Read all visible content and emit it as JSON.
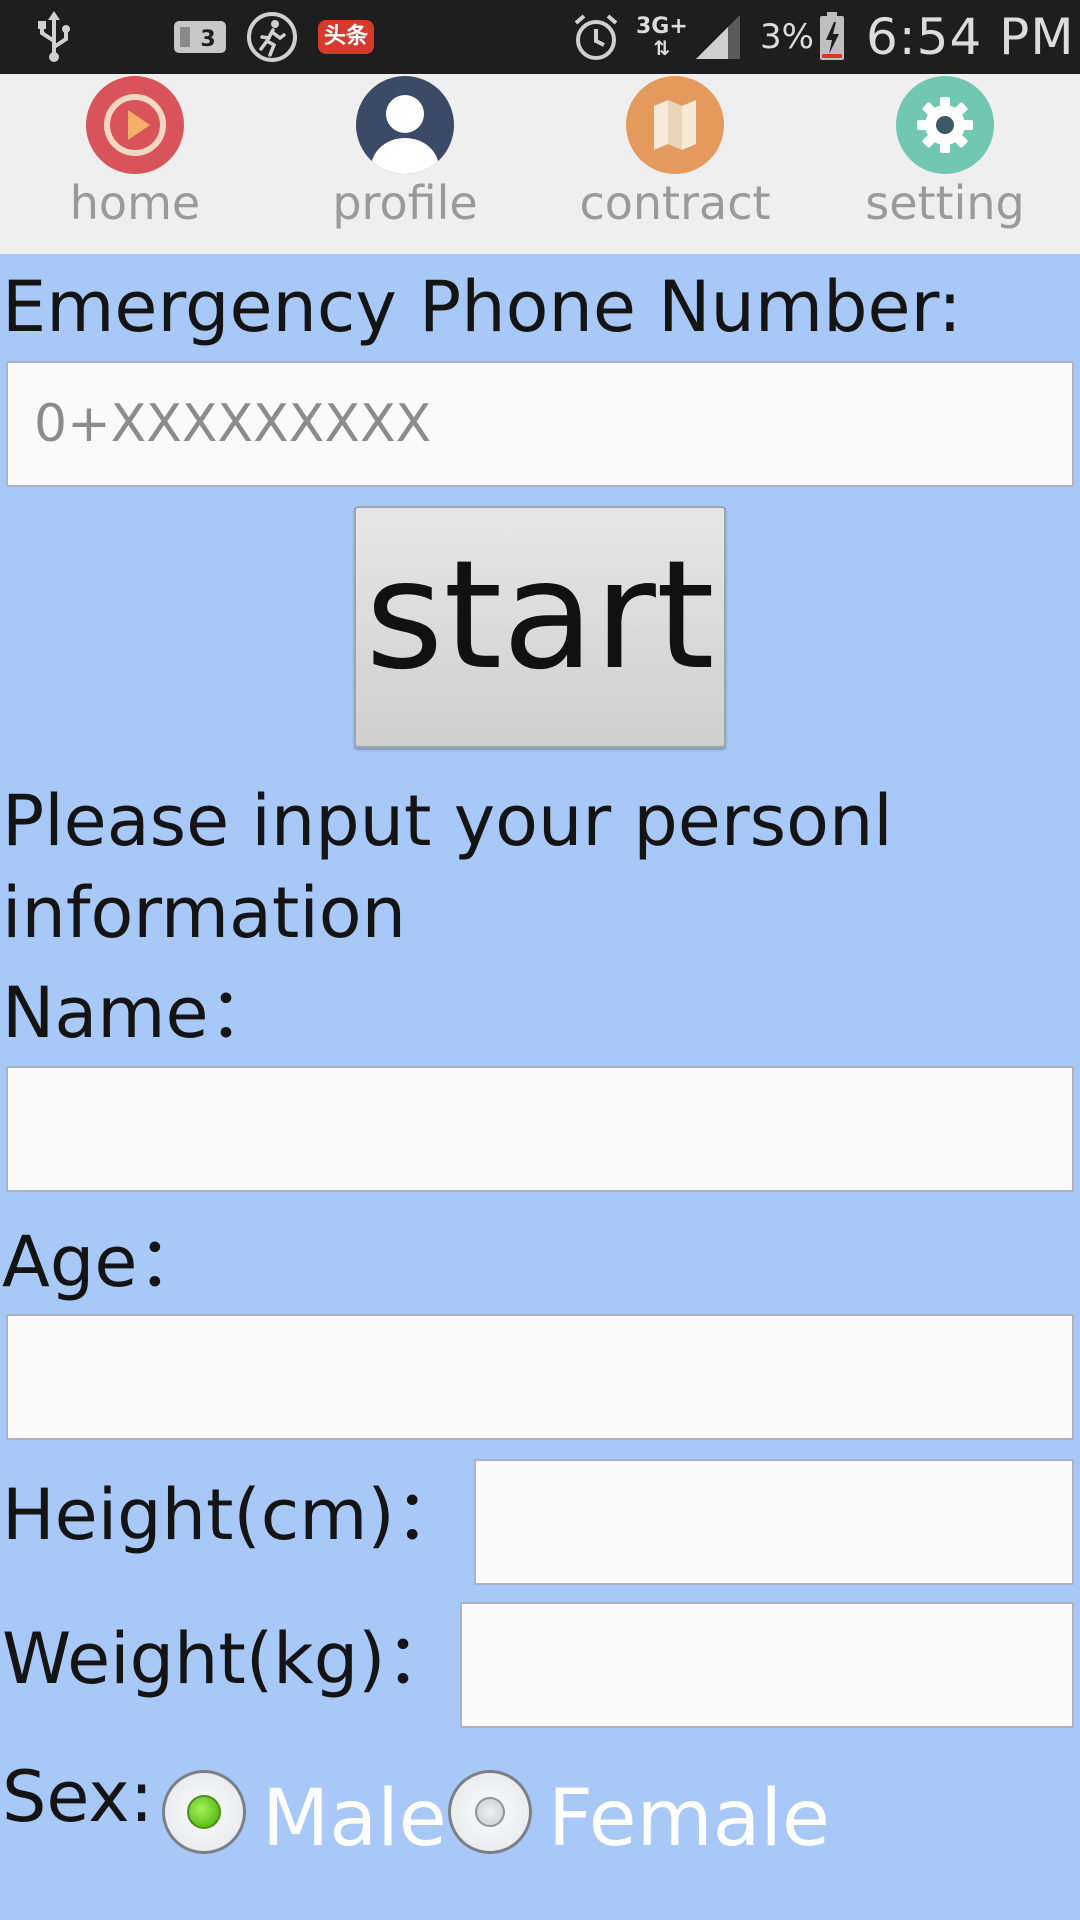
{
  "status_bar": {
    "network": "3G+",
    "news_badge": "头条",
    "battery_percent": "3%",
    "time": "6:54 PM",
    "icons": [
      "usb-icon",
      "notification-icon",
      "runner-icon",
      "news-icon",
      "alarm-icon",
      "network-icon",
      "signal-icon",
      "battery-icon"
    ]
  },
  "tabs": [
    {
      "label": "home",
      "icon": "play-icon",
      "color": "#d9545a"
    },
    {
      "label": "profile",
      "icon": "person-icon",
      "color": "#3b4a66"
    },
    {
      "label": "contract",
      "icon": "map-icon",
      "color": "#e39a5c"
    },
    {
      "label": "setting",
      "icon": "gear-icon",
      "color": "#72c7b3"
    }
  ],
  "form": {
    "emergency_label": "Emergency Phone Number:",
    "emergency_placeholder": "0+XXXXXXXXX",
    "emergency_value": "",
    "start_label": "start",
    "prompt": "Please input your personl information",
    "name_label": "Name：",
    "name_value": "",
    "age_label": "Age：",
    "age_value": "",
    "height_label": "Height(cm)：",
    "height_value": "",
    "weight_label": "Weight(kg)：",
    "weight_value": "",
    "sex_label": "Sex:",
    "sex_options": [
      "Male",
      "Female"
    ],
    "sex_selected": "Male"
  },
  "colors": {
    "background": "#a8c8f8",
    "tab_bar": "#efefef",
    "status_bar": "#1e1e1e"
  }
}
